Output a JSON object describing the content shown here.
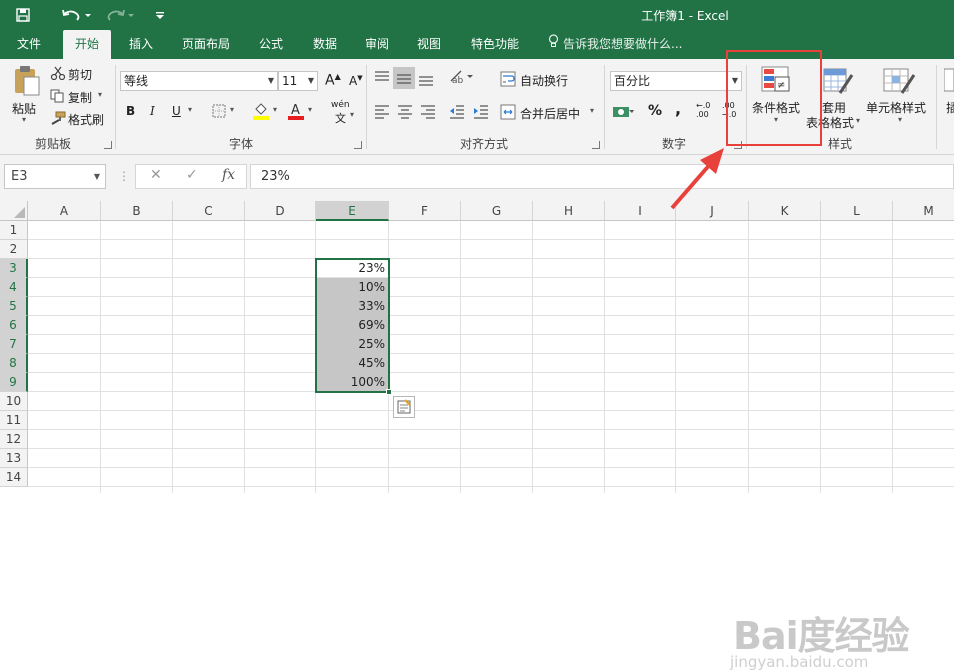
{
  "window": {
    "title": "工作簿1 - Excel"
  },
  "quick_access": {
    "save_icon": "save-icon",
    "undo_icon": "undo-icon",
    "redo_icon": "redo-icon",
    "customize_icon": "customize-qat-icon"
  },
  "tabs": [
    "文件",
    "开始",
    "插入",
    "页面布局",
    "公式",
    "数据",
    "审阅",
    "视图",
    "特色功能"
  ],
  "active_tab": "开始",
  "tell_me": "告诉我您想要做什么...",
  "ribbon": {
    "clipboard": {
      "paste": "粘贴",
      "cut": "剪切",
      "copy": "复制",
      "format_painter": "格式刷",
      "label": "剪贴板"
    },
    "font": {
      "name": "等线",
      "size": "11",
      "bold": "B",
      "italic": "I",
      "underline": "U",
      "wen": "wén",
      "wen2": "文",
      "grow": "A",
      "shrink": "A",
      "label": "字体"
    },
    "alignment": {
      "wrap": "自动换行",
      "merge": "合并后居中",
      "label": "对齐方式"
    },
    "number": {
      "format": "百分比",
      "percent": "%",
      "comma": ",",
      "inc_decimal": "←.0 .00",
      "dec_decimal": ".00 →.0",
      "label": "数字"
    },
    "styles": {
      "conditional": "条件格式",
      "table_line1": "套用",
      "table_line2": "表格格式",
      "cell_styles": "单元格样式",
      "label": "样式"
    },
    "cells": {
      "insert": "插"
    }
  },
  "formula_bar": {
    "name_box": "E3",
    "cancel": "✕",
    "enter": "✓",
    "fx": "fx",
    "content": "23%"
  },
  "columns": [
    "A",
    "B",
    "C",
    "D",
    "E",
    "F",
    "G",
    "H",
    "I",
    "J",
    "K",
    "L",
    "M"
  ],
  "rows": [
    "1",
    "2",
    "3",
    "4",
    "5",
    "6",
    "7",
    "8",
    "9",
    "10",
    "11",
    "12",
    "13",
    "14"
  ],
  "cells": {
    "E3": "23%",
    "E4": "10%",
    "E5": "33%",
    "E6": "69%",
    "E7": "25%",
    "E8": "45%",
    "E9": "100%"
  },
  "selected_column": "E",
  "selected_rows": [
    "3",
    "4",
    "5",
    "6",
    "7",
    "8",
    "9"
  ],
  "colors": {
    "brand": "#217346",
    "highlight": "#e8413c",
    "selection_fill": "#c6c6c6"
  },
  "watermark": {
    "logo": "Bai度经验",
    "url": "jingyan.baidu.com"
  }
}
